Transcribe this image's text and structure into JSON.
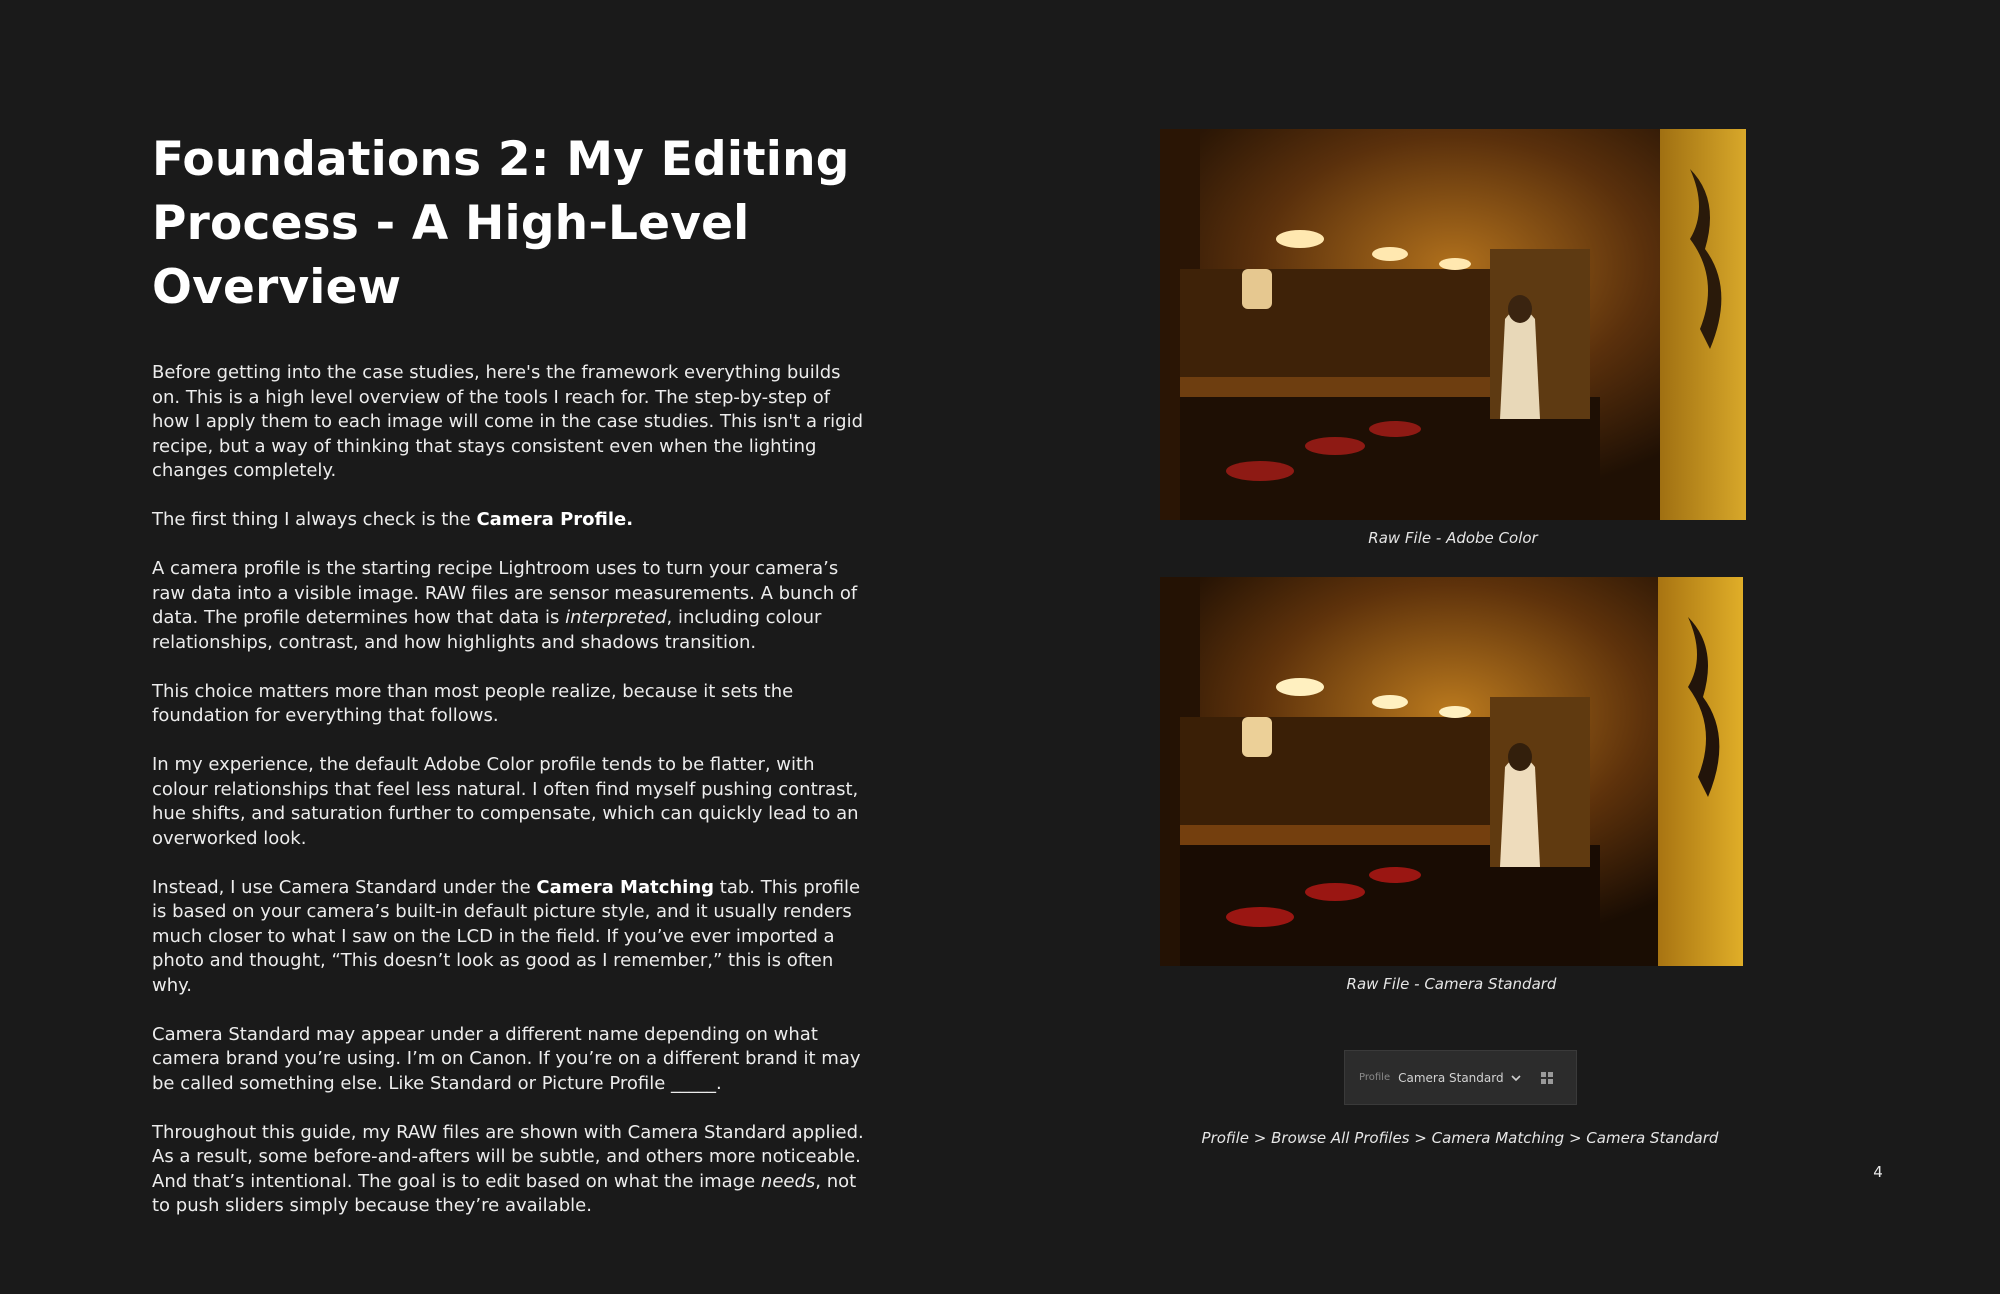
{
  "page": {
    "background": "#1a1a1a",
    "number": "4"
  },
  "title": {
    "line1": "Foundations 2: My Editing",
    "line2": "Process - A High-Level Overview"
  },
  "paragraphs": {
    "p1": "Before getting into the case studies, here's the framework everything builds on. This is a high level overview of the tools I reach for. The step-by-step of how I apply them to each image will come in the case studies. This isn't a rigid recipe, but a way of thinking that stays consistent even when the lighting changes completely.",
    "p2_before": "The first thing I always check is the ",
    "p2_bold": "Camera Profile.",
    "p3_before": "A camera profile is the starting recipe Lightroom uses to turn your camera’s raw data into a visible image. RAW files are sensor measurements. A bunch of data. The profile determines how that data is ",
    "p3_italic": "interpreted",
    "p3_after": ", including colour relationships, contrast, and how highlights and shadows transition.",
    "p4": "This choice matters more than most people realize, because it sets the foundation for everything that follows.",
    "p5": "In my experience, the default Adobe Color profile tends to be flatter, with colour relationships that feel less natural. I often find myself pushing contrast, hue shifts, and saturation further to compensate, which can quickly lead to an overworked look.",
    "p6_before": "Instead, I use Camera Standard under the ",
    "p6_bold": "Camera Matching",
    "p6_after": " tab. This profile is based on your camera’s built-in default picture style, and it usually renders much closer to what I saw on the LCD in the field. If you’ve ever imported a photo and thought, “This doesn’t look as good as I remember,” this is often why.",
    "p7": "Camera Standard may appear under a different name depending on what camera brand you’re using. I’m on Canon. If you’re on a different brand it may be called something else. Like Standard or Picture Profile _____.",
    "p8_before": "Throughout this guide, my RAW files are shown with Camera Standard applied. As a result, some before-and-afters will be subtle, and others more noticeable. And that’s intentional. The goal is to edit based on what the image ",
    "p8_italic": "needs",
    "p8_after": ", not to push sliders simply because they’re available."
  },
  "figures": {
    "photo1_caption": "Raw File - Adobe Color",
    "photo2_caption": "Raw File - Camera Standard",
    "profile_caption": "Profile > Browse All Profiles > Camera Matching > Camera Standard"
  },
  "profile_widget": {
    "label": "Profile",
    "value": "Camera Standard",
    "chevron_icon": "chevron-down-icon",
    "browse_icon": "grid-icon"
  }
}
